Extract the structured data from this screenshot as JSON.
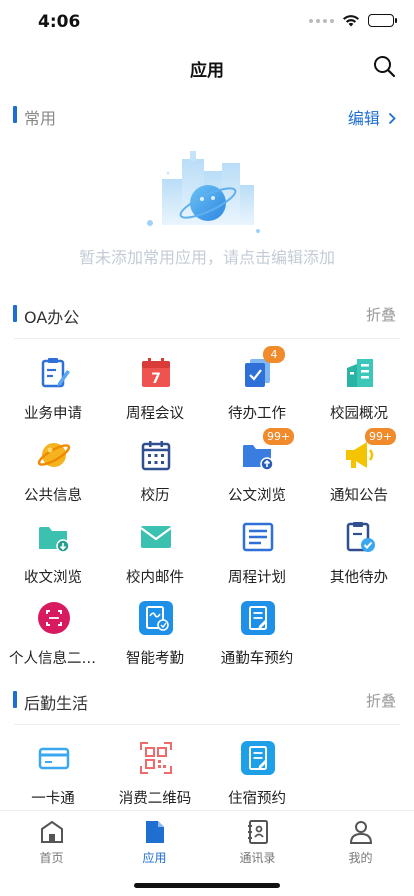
{
  "status_bar": {
    "time": "4:06"
  },
  "nav": {
    "title": "应用"
  },
  "favorites": {
    "title": "常用",
    "action": "编辑",
    "empty_text": "暂未添加常用应用，请点击编辑添加"
  },
  "oa": {
    "title": "OA办公",
    "action": "折叠",
    "apps": [
      {
        "label": "业务申请",
        "icon": "clipboard-edit-icon"
      },
      {
        "label": "周程会议",
        "icon": "calendar-7-icon"
      },
      {
        "label": "待办工作",
        "icon": "todo-doc-icon",
        "badge": "4"
      },
      {
        "label": "校园概况",
        "icon": "campus-building-icon"
      },
      {
        "label": "公共信息",
        "icon": "planet-icon"
      },
      {
        "label": "校历",
        "icon": "calendar-grid-icon"
      },
      {
        "label": "公文浏览",
        "icon": "folder-upload-icon",
        "badge": "99+"
      },
      {
        "label": "通知公告",
        "icon": "megaphone-icon",
        "badge": "99+"
      },
      {
        "label": "收文浏览",
        "icon": "folder-download-icon"
      },
      {
        "label": "校内邮件",
        "icon": "mail-icon"
      },
      {
        "label": "周程计划",
        "icon": "list-doc-icon"
      },
      {
        "label": "其他待办",
        "icon": "doc-check-icon"
      },
      {
        "label": "个人信息二维码",
        "icon": "scan-frame-icon"
      },
      {
        "label": "智能考勤",
        "icon": "attendance-icon"
      },
      {
        "label": "通勤车预约",
        "icon": "bus-booking-icon"
      }
    ]
  },
  "logistics": {
    "title": "后勤生活",
    "action": "折叠",
    "apps": [
      {
        "label": "一卡通",
        "icon": "card-icon"
      },
      {
        "label": "消费二维码",
        "icon": "qrcode-icon"
      },
      {
        "label": "住宿预约",
        "icon": "lodging-booking-icon"
      }
    ]
  },
  "tabs": [
    {
      "label": "首页",
      "icon": "home-icon",
      "active": false
    },
    {
      "label": "应用",
      "icon": "apps-doc-icon",
      "active": true
    },
    {
      "label": "通讯录",
      "icon": "contacts-book-icon",
      "active": false
    },
    {
      "label": "我的",
      "icon": "profile-icon",
      "active": false
    }
  ],
  "colors": {
    "accent": "#1f6fd1",
    "badge": "#f08a2b",
    "muted": "#999999"
  }
}
